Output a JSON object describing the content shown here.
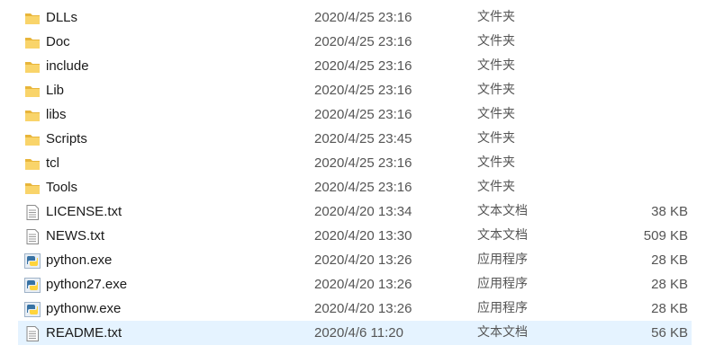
{
  "files": [
    {
      "name": "DLLs",
      "date": "2020/4/25 23:16",
      "type": "文件夹",
      "size": "",
      "icon": "folder-icon"
    },
    {
      "name": "Doc",
      "date": "2020/4/25 23:16",
      "type": "文件夹",
      "size": "",
      "icon": "folder-icon"
    },
    {
      "name": "include",
      "date": "2020/4/25 23:16",
      "type": "文件夹",
      "size": "",
      "icon": "folder-icon"
    },
    {
      "name": "Lib",
      "date": "2020/4/25 23:16",
      "type": "文件夹",
      "size": "",
      "icon": "folder-icon"
    },
    {
      "name": "libs",
      "date": "2020/4/25 23:16",
      "type": "文件夹",
      "size": "",
      "icon": "folder-icon"
    },
    {
      "name": "Scripts",
      "date": "2020/4/25 23:45",
      "type": "文件夹",
      "size": "",
      "icon": "folder-icon"
    },
    {
      "name": "tcl",
      "date": "2020/4/25 23:16",
      "type": "文件夹",
      "size": "",
      "icon": "folder-icon"
    },
    {
      "name": "Tools",
      "date": "2020/4/25 23:16",
      "type": "文件夹",
      "size": "",
      "icon": "folder-icon"
    },
    {
      "name": "LICENSE.txt",
      "date": "2020/4/20 13:34",
      "type": "文本文档",
      "size": "38 KB",
      "icon": "text-file-icon"
    },
    {
      "name": "NEWS.txt",
      "date": "2020/4/20 13:30",
      "type": "文本文档",
      "size": "509 KB",
      "icon": "text-file-icon"
    },
    {
      "name": "python.exe",
      "date": "2020/4/20 13:26",
      "type": "应用程序",
      "size": "28 KB",
      "icon": "python-app-icon"
    },
    {
      "name": "python27.exe",
      "date": "2020/4/20 13:26",
      "type": "应用程序",
      "size": "28 KB",
      "icon": "python-app-icon"
    },
    {
      "name": "pythonw.exe",
      "date": "2020/4/20 13:26",
      "type": "应用程序",
      "size": "28 KB",
      "icon": "python-app-icon"
    },
    {
      "name": "README.txt",
      "date": "2020/4/6 11:20",
      "type": "文本文档",
      "size": "56 KB",
      "icon": "text-file-icon",
      "selected": true
    }
  ],
  "colors": {
    "selection": "#e5f3ff",
    "folder": "#f7c948",
    "python_blue": "#3772a4",
    "python_yellow": "#ffd43b"
  }
}
